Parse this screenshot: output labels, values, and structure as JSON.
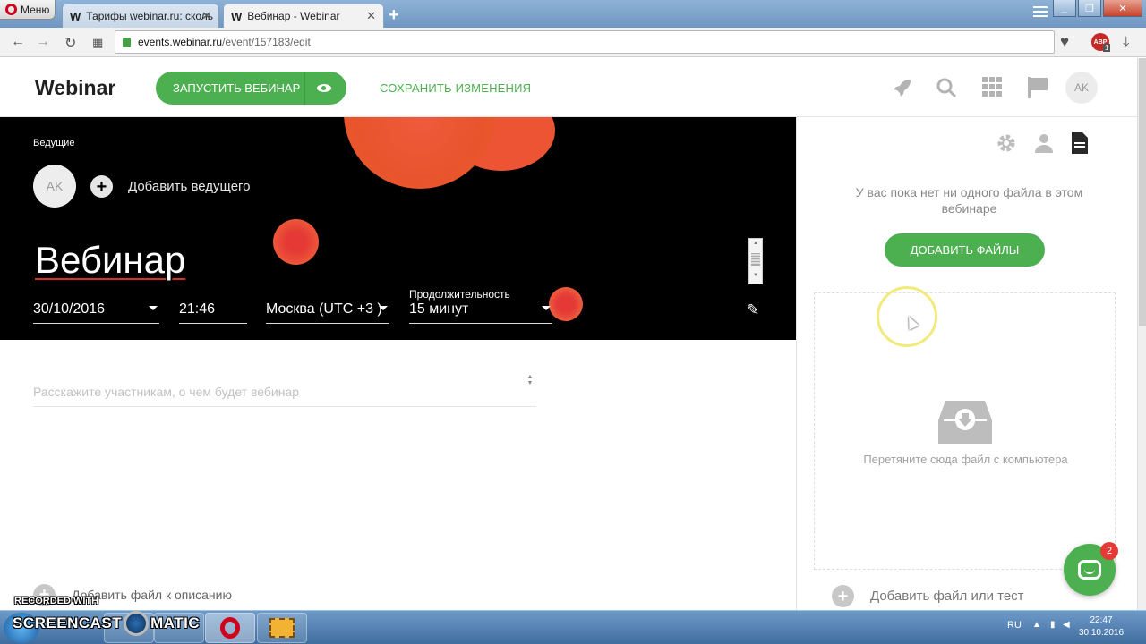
{
  "browser": {
    "menu_label": "Меню",
    "tabs": [
      {
        "favicon": "W",
        "title": "Тарифы webinar.ru: сколь",
        "close": "✕"
      },
      {
        "favicon": "W",
        "title": "Вебинар - Webinar",
        "close": "✕"
      }
    ],
    "new_tab": "+",
    "url_host": "events.webinar.ru",
    "url_path": "/event/157183/edit",
    "abp_label": "ABP",
    "abp_count": "1"
  },
  "header": {
    "brand": "Webinar",
    "launch_button": "ЗАПУСТИТЬ ВЕБИНАР",
    "save_button": "СОХРАНИТЬ ИЗМЕНЕНИЯ",
    "avatar_initials": "AK"
  },
  "event": {
    "hosts_label": "Ведущие",
    "host_initials": "AK",
    "add_host": "Добавить ведущего",
    "title": "Вебинар",
    "date": "30/10/2016",
    "time": "21:46",
    "timezone": "Москва (UTC +3 )",
    "duration_label": "Продолжительность",
    "duration": "15 минут",
    "description_placeholder": "Расскажите участникам, о чем будет вебинар",
    "add_description_file": "Добавить файл к описанию"
  },
  "files_panel": {
    "empty_text": "У вас пока нет ни одного файла в этом вебинаре",
    "add_files_button": "ДОБАВИТЬ ФАЙЛЫ",
    "drop_text": "Перетяните сюда файл с компьютера",
    "add_file_or_test": "Добавить файл или тест"
  },
  "chat": {
    "badge": "2"
  },
  "taskbar": {
    "watermark_top": "RECORDED WITH",
    "watermark_left": "SCREENCAST",
    "watermark_right": "MATIC",
    "language": "RU",
    "time": "22:47",
    "date": "30.10.2016"
  },
  "colors": {
    "accent_green": "#4caf50",
    "hero_bg": "#000000",
    "blob": "#ee5533"
  },
  "icons": [
    "rocket-icon",
    "search-icon",
    "apps-grid-icon",
    "flag-icon",
    "settings-icon",
    "person-icon",
    "document-icon",
    "pencil-icon",
    "download-tray-icon",
    "chat-icon"
  ]
}
